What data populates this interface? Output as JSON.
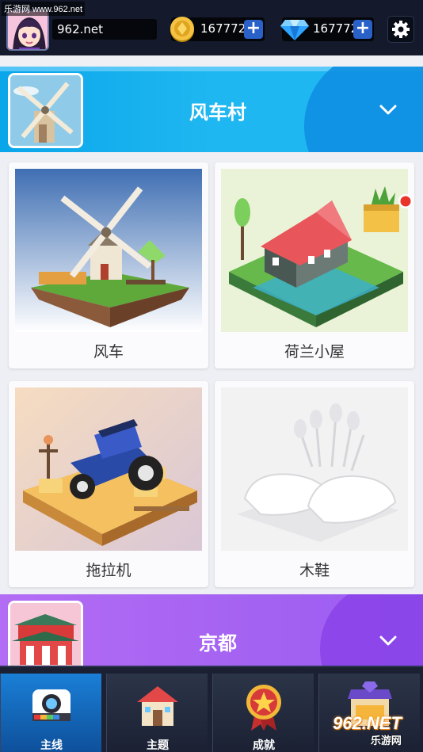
{
  "watermark": "乐游网 www.962.net",
  "header": {
    "username": "962.net",
    "coins": "167772",
    "gems": "167772",
    "coin_icon": "gold-coin-icon",
    "gem_icon": "blue-diamond-icon",
    "plus_label": "+"
  },
  "categories": [
    {
      "title": "风车村",
      "color": "#1fb7f1",
      "expanded": true
    },
    {
      "title": "京都",
      "color": "#a062f2",
      "expanded": false
    }
  ],
  "levels": [
    {
      "label": "风车",
      "locked": false
    },
    {
      "label": "荷兰小屋",
      "locked": false,
      "has_new_badge": true
    },
    {
      "label": "拖拉机",
      "locked": false
    },
    {
      "label": "木鞋",
      "locked": true
    }
  ],
  "nav": {
    "tabs": [
      {
        "label": "主线",
        "active": true,
        "icon": "camera-icon"
      },
      {
        "label": "主题",
        "active": false,
        "icon": "house-icon"
      },
      {
        "label": "成就",
        "active": false,
        "icon": "star-medal-icon"
      },
      {
        "label": "",
        "active": false,
        "icon": "shop-icon"
      }
    ]
  },
  "brand_watermark": {
    "logo": "962.NET",
    "sub": "乐游网"
  },
  "colors": {
    "topbar": "#141a2b",
    "accent_blue": "#2a61c8",
    "badge_red": "#e8342a"
  }
}
